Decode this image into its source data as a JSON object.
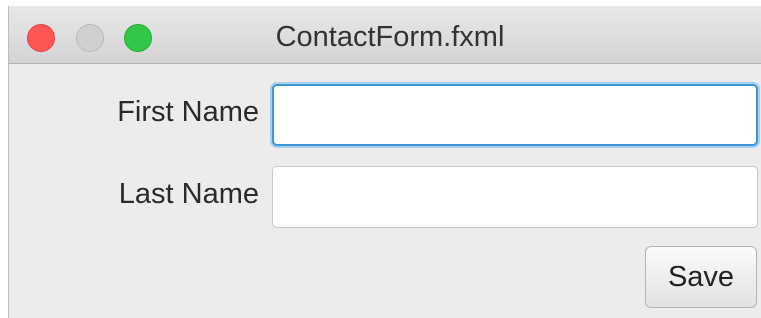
{
  "window": {
    "title": "ContactForm.fxml"
  },
  "form": {
    "first_name_label": "First Name",
    "first_name_value": "",
    "last_name_label": "Last Name",
    "last_name_value": "",
    "save_label": "Save"
  },
  "icons": {
    "close": "close-window-icon",
    "minimize": "minimize-window-icon",
    "maximize": "maximize-window-icon"
  },
  "colors": {
    "close": "#fc5753",
    "minimize": "#d0d0d0",
    "maximize": "#33c748",
    "focus": "#3d97d4"
  }
}
